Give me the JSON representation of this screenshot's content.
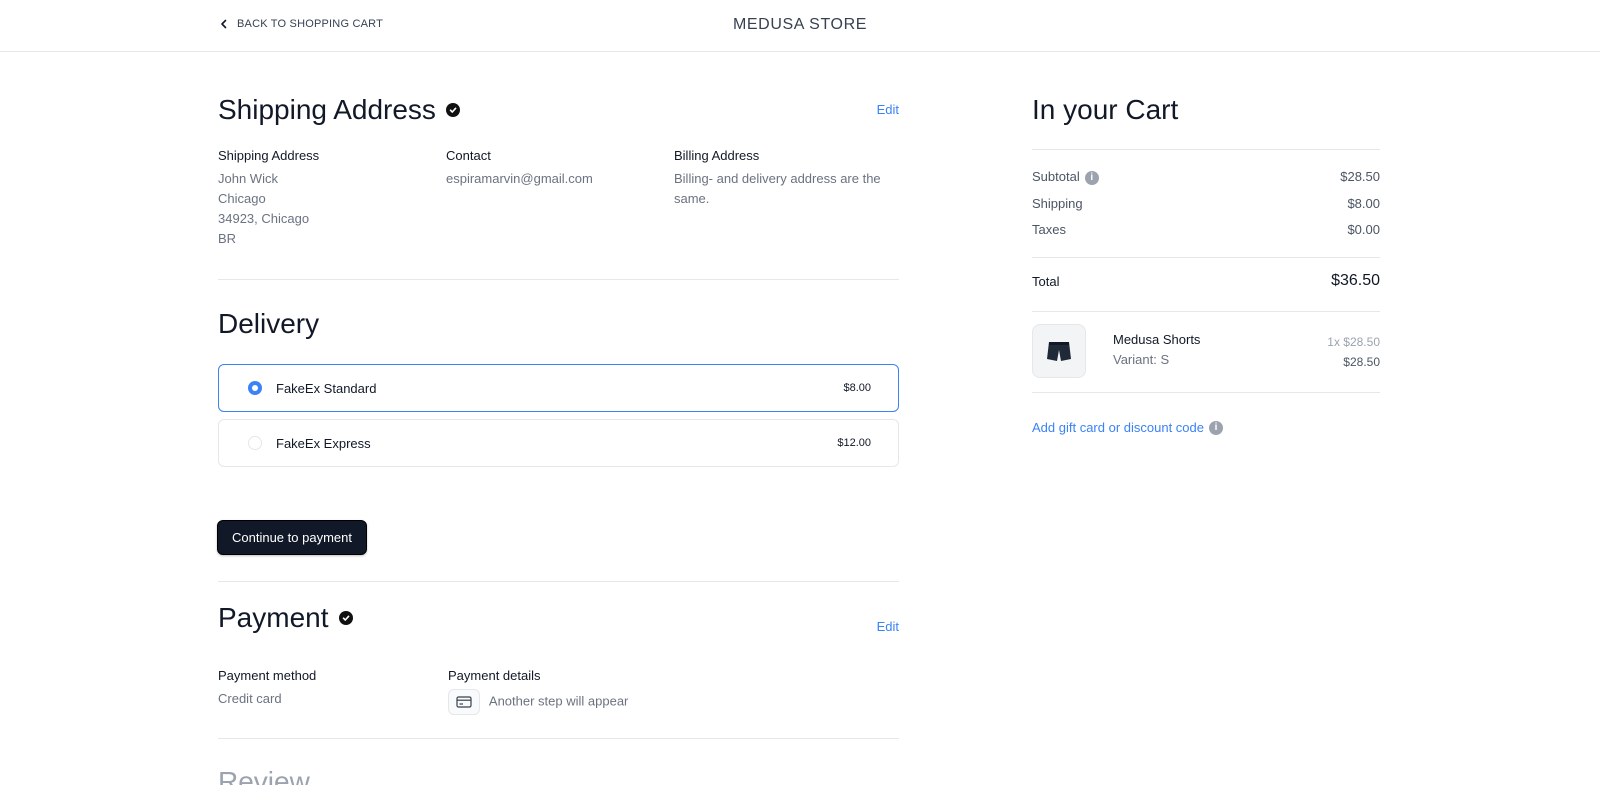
{
  "header": {
    "back_label": "BACK TO SHOPPING CART",
    "store_name": "MEDUSA STORE"
  },
  "shipping": {
    "title": "Shipping Address",
    "edit_label": "Edit",
    "address": {
      "label": "Shipping Address",
      "lines": [
        "John Wick",
        "Chicago",
        "34923, Chicago",
        "BR"
      ]
    },
    "contact": {
      "label": "Contact",
      "email": "espiramarvin@gmail.com"
    },
    "billing": {
      "label": "Billing Address",
      "text": "Billing- and delivery address are the same."
    }
  },
  "delivery": {
    "title": "Delivery",
    "options": [
      {
        "name": "FakeEx Standard",
        "price": "$8.00",
        "selected": true
      },
      {
        "name": "FakeEx Express",
        "price": "$12.00",
        "selected": false
      }
    ],
    "continue_label": "Continue to payment"
  },
  "payment": {
    "title": "Payment",
    "edit_label": "Edit",
    "method_label": "Payment method",
    "method_value": "Credit card",
    "details_label": "Payment details",
    "details_value": "Another step will appear"
  },
  "review": {
    "title": "Review"
  },
  "cart": {
    "title": "In your Cart",
    "subtotal_label": "Subtotal",
    "subtotal_value": "$28.50",
    "shipping_label": "Shipping",
    "shipping_value": "$8.00",
    "taxes_label": "Taxes",
    "taxes_value": "$0.00",
    "total_label": "Total",
    "total_value": "$36.50",
    "item": {
      "name": "Medusa Shorts",
      "variant": "Variant: S",
      "qty_price": "1x $28.50",
      "line_total": "$28.50"
    },
    "gift_label": "Add gift card or discount code"
  },
  "colors": {
    "accent": "#3b82f6",
    "button_bg": "#111827",
    "border": "#e5e7eb",
    "muted_text": "#6b7280"
  }
}
